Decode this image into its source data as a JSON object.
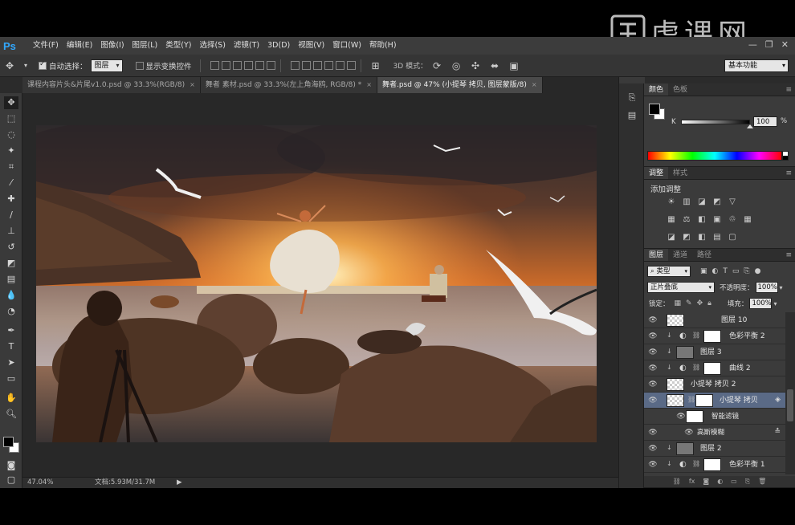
{
  "app": {
    "logo": "Ps",
    "menu": [
      "文件(F)",
      "编辑(E)",
      "图像(I)",
      "图层(L)",
      "类型(Y)",
      "选择(S)",
      "滤镜(T)",
      "3D(D)",
      "视图(V)",
      "窗口(W)",
      "帮助(H)"
    ],
    "watermark": "虎课网"
  },
  "options": {
    "auto_select_label": "自动选择：",
    "auto_select_value": "图层",
    "transform_label": "显示变换控件",
    "mode3d_label": "3D 模式：",
    "workspace": "基本功能"
  },
  "tabs": [
    {
      "label": "课程内容片头&片尾v1.0.psd @ 33.3%(RGB/8)",
      "active": false
    },
    {
      "label": "舞者 素材.psd @ 33.3%(左上角海鸥, RGB/8) *",
      "active": false
    },
    {
      "label": "舞者.psd @ 47% (小提琴 拷贝, 图层蒙版/8)",
      "active": true
    }
  ],
  "status": {
    "zoom": "47.04%",
    "doc": "文档:5.93M/31.7M"
  },
  "color_panel": {
    "tabs": [
      "颜色",
      "色板"
    ],
    "channel": "K",
    "value": "100",
    "value_fraction": 1.0,
    "unit": "%"
  },
  "adjust_panel": {
    "tabs": [
      "调整",
      "样式"
    ],
    "title": "添加调整"
  },
  "layers_panel": {
    "tabs": [
      "图层",
      "通道",
      "路径"
    ],
    "kind": "类型",
    "blend_mode": "正片叠底",
    "opacity_label": "不透明度：",
    "opacity": "100%",
    "lock_label": "锁定：",
    "fill_label": "填充：",
    "fill": "100%",
    "layers": [
      {
        "name": "图层 10",
        "kind": "layer",
        "clip": false,
        "selected": false
      },
      {
        "name": "色彩平衡 2",
        "kind": "adjustment",
        "clip": true,
        "selected": false
      },
      {
        "name": "图层 3",
        "kind": "layer-gray",
        "clip": true,
        "selected": false
      },
      {
        "name": "曲线 2",
        "kind": "adjustment",
        "clip": true,
        "selected": false
      },
      {
        "name": "小提琴 拷贝 2",
        "kind": "smart",
        "clip": false,
        "selected": false
      },
      {
        "name": "小提琴 拷贝",
        "kind": "smart-mask",
        "clip": false,
        "selected": true
      },
      {
        "name": "智能滤镜",
        "kind": "filter-group",
        "clip": false,
        "selected": false
      },
      {
        "name": "高斯模糊",
        "kind": "filter",
        "clip": false,
        "selected": false
      },
      {
        "name": "图层 2",
        "kind": "layer-gray",
        "clip": true,
        "selected": false
      },
      {
        "name": "色彩平衡 1",
        "kind": "adjustment",
        "clip": true,
        "selected": false
      }
    ]
  },
  "colors": {
    "ps_blue": "#31a8ff",
    "selected_layer": "#5a6a86",
    "sky_orange": "#e8883a"
  }
}
